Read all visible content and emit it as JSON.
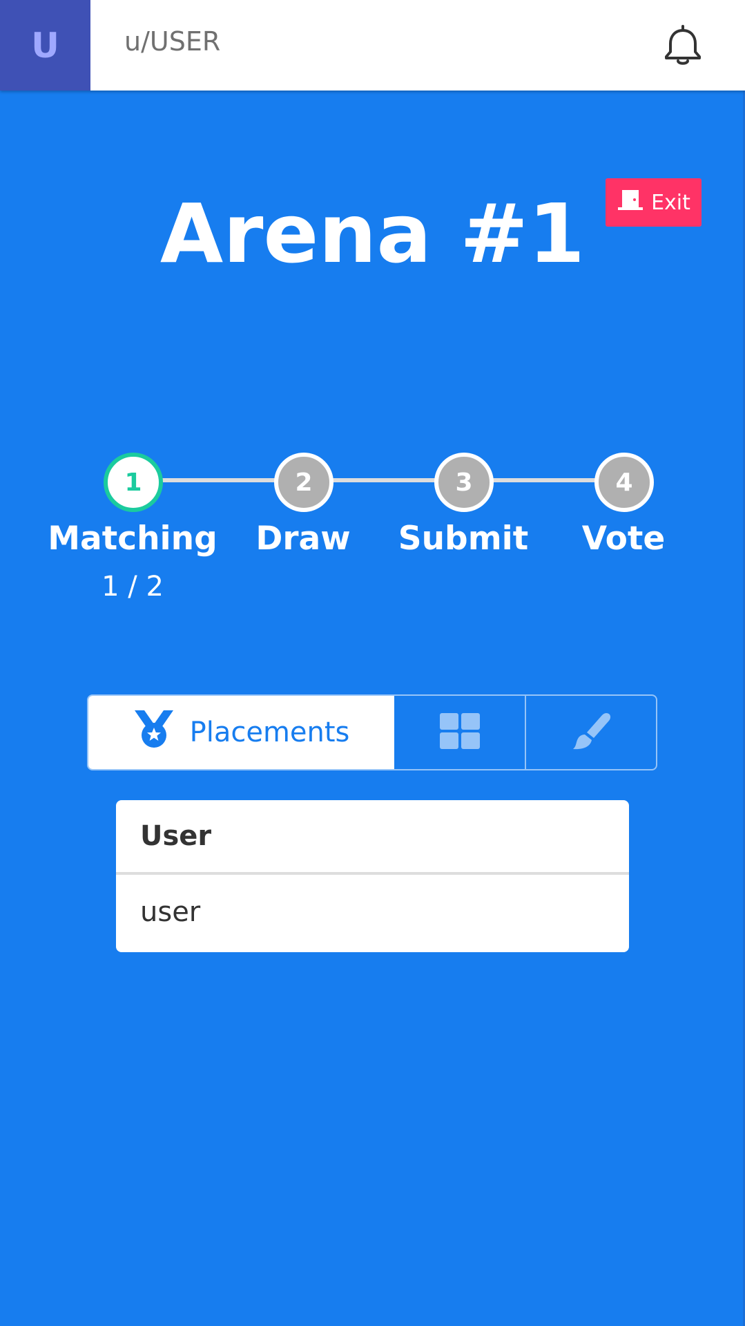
{
  "header": {
    "avatar_letter": "U",
    "username": "u/USER",
    "notifications_icon": "bell-icon"
  },
  "arena": {
    "title": "Arena #1",
    "exit_label": "Exit",
    "exit_icon": "door-icon"
  },
  "steps": [
    {
      "number": "1",
      "label": "Matching",
      "sub": "1 / 2",
      "state": "active"
    },
    {
      "number": "2",
      "label": "Draw",
      "state": "inactive"
    },
    {
      "number": "3",
      "label": "Submit",
      "state": "inactive"
    },
    {
      "number": "4",
      "label": "Vote",
      "state": "inactive"
    }
  ],
  "tabs": [
    {
      "label": "Placements",
      "icon": "medal-icon",
      "selected": true
    },
    {
      "label": "",
      "icon": "grid-icon",
      "selected": false
    },
    {
      "label": "",
      "icon": "paintbrush-icon",
      "selected": false
    }
  ],
  "table": {
    "header": "User",
    "rows": [
      "user"
    ]
  },
  "colors": {
    "background": "#177DEF",
    "avatar_bg": "#3F51B5",
    "exit_button": "#FF3366",
    "active_step": "#1BCB9E",
    "inactive_step": "#B0B0B0"
  }
}
